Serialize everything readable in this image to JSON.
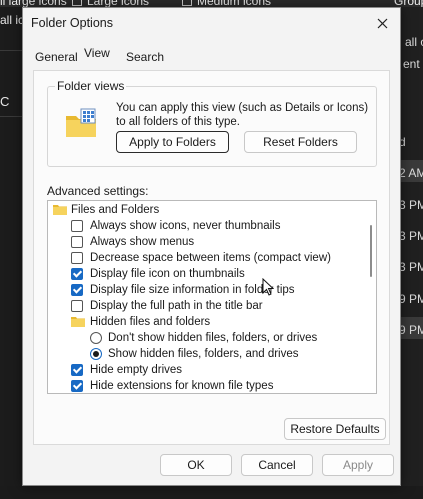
{
  "background": {
    "top_texts": [
      "ll large icons",
      "Large icons",
      "Medium icons",
      "Group b"
    ],
    "left_texts": [
      "all ic",
      "C"
    ],
    "right_texts": [
      "all o",
      "ent vi",
      "d",
      "2 AM",
      "3 PM",
      "3 PM",
      "3 PM",
      "9 PM",
      "9 PM"
    ]
  },
  "dialog": {
    "title": "Folder Options",
    "tabs": [
      "General",
      "View",
      "Search"
    ],
    "active_tab": "View",
    "folder_views": {
      "legend": "Folder views",
      "description": "You can apply this view (such as Details or Icons) to all folders of this type.",
      "apply_button": "Apply to Folders",
      "reset_button": "Reset Folders"
    },
    "advanced_label": "Advanced settings:",
    "tree": [
      {
        "type": "folder",
        "label": "Files and Folders"
      },
      {
        "type": "checkbox",
        "label": "Always show icons, never thumbnails",
        "checked": false
      },
      {
        "type": "checkbox",
        "label": "Always show menus",
        "checked": false
      },
      {
        "type": "checkbox",
        "label": "Decrease space between items (compact view)",
        "checked": false
      },
      {
        "type": "checkbox",
        "label": "Display file icon on thumbnails",
        "checked": true
      },
      {
        "type": "checkbox",
        "label": "Display file size information in folder tips",
        "checked": true
      },
      {
        "type": "checkbox",
        "label": "Display the full path in the title bar",
        "checked": false
      },
      {
        "type": "folder",
        "label": "Hidden files and folders"
      },
      {
        "type": "radio",
        "label": "Don't show hidden files, folders, or drives",
        "checked": false
      },
      {
        "type": "radio",
        "label": "Show hidden files, folders, and drives",
        "checked": true
      },
      {
        "type": "checkbox",
        "label": "Hide empty drives",
        "checked": true
      },
      {
        "type": "checkbox",
        "label": "Hide extensions for known file types",
        "checked": true
      }
    ],
    "restore_button": "Restore Defaults",
    "ok_button": "OK",
    "cancel_button": "Cancel",
    "apply_button": "Apply"
  },
  "colors": {
    "accent": "#1769c4",
    "folder": "#f2c744",
    "dialog_bg": "#f3f3f3",
    "dark_bg": "#1f1f1f"
  }
}
